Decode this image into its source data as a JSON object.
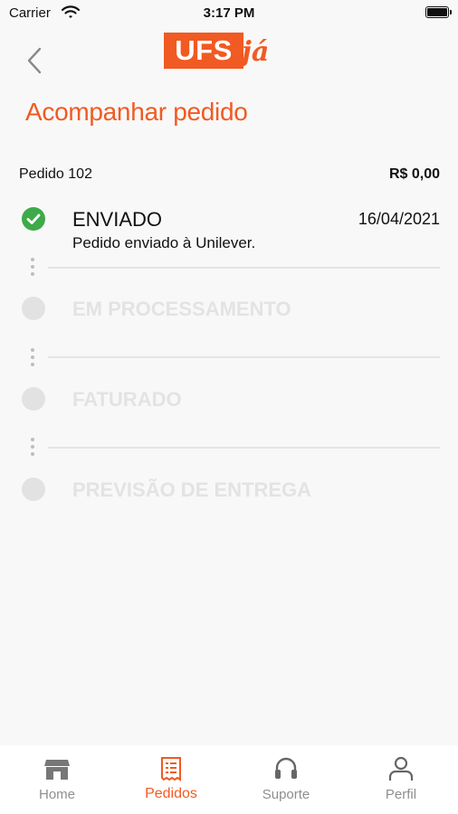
{
  "status_bar": {
    "carrier": "Carrier",
    "time": "3:17 PM"
  },
  "header": {
    "logo_main": "UFS",
    "logo_script": "já"
  },
  "page": {
    "title": "Acompanhar pedido"
  },
  "order": {
    "label": "Pedido 102",
    "total": "R$ 0,00"
  },
  "steps": [
    {
      "title": "ENVIADO",
      "description": "Pedido enviado à Unilever.",
      "date": "16/04/2021",
      "status": "done"
    },
    {
      "title": "EM PROCESSAMENTO",
      "status": "pending"
    },
    {
      "title": "FATURADO",
      "status": "pending"
    },
    {
      "title": "PREVISÃO DE ENTREGA",
      "status": "pending"
    }
  ],
  "tabbar": {
    "items": [
      {
        "label": "Home",
        "icon": "store-icon"
      },
      {
        "label": "Pedidos",
        "icon": "receipt-icon"
      },
      {
        "label": "Suporte",
        "icon": "headset-icon"
      },
      {
        "label": "Perfil",
        "icon": "person-icon"
      }
    ],
    "active": "Pedidos"
  },
  "colors": {
    "accent": "#f15a22",
    "success": "#3eaa49",
    "inactive": "#e2e2e2",
    "tab_inactive": "#8e8e8e"
  }
}
